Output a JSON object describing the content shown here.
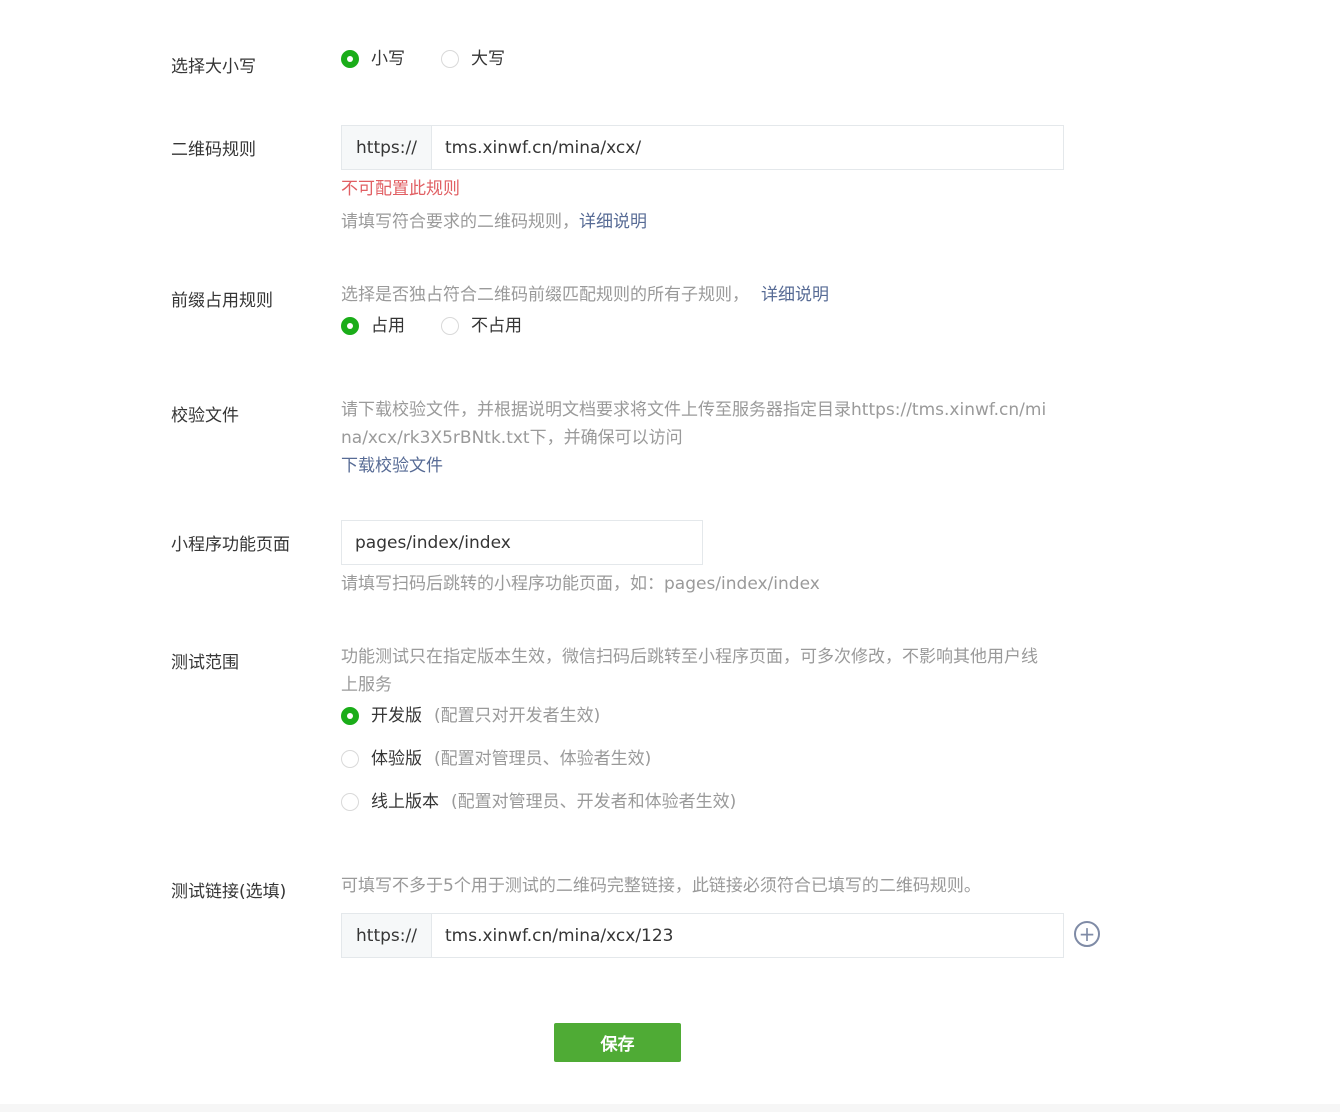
{
  "case": {
    "label": "选择大小写",
    "options": [
      {
        "label": "小写",
        "checked": true
      },
      {
        "label": "大写",
        "checked": false
      }
    ]
  },
  "qr_rule": {
    "label": "二维码规则",
    "prefix": "https://",
    "value": "tms.xinwf.cn/mina/xcx/",
    "error": "不可配置此规则",
    "hint": "请填写符合要求的二维码规则，",
    "hint_link": "详细说明"
  },
  "prefix_rule": {
    "label": "前缀占用规则",
    "hint": "选择是否独占符合二维码前缀匹配规则的所有子规则，",
    "hint_link": "详细说明",
    "options": [
      {
        "label": "占用",
        "checked": true
      },
      {
        "label": "不占用",
        "checked": false
      }
    ]
  },
  "verify_file": {
    "label": "校验文件",
    "hint_line1": "请下载校验文件，并根据说明文档要求将文件上传至服务器指定目录https://tms.xinwf.cn/mi",
    "hint_line2": "na/xcx/rk3X5rBNtk.txt下，并确保可以访问",
    "download_link": "下载校验文件"
  },
  "page_path": {
    "label": "小程序功能页面",
    "value": "pages/index/index",
    "hint": "请填写扫码后跳转的小程序功能页面，如：pages/index/index"
  },
  "test_scope": {
    "label": "测试范围",
    "hint_line1": "功能测试只在指定版本生效，微信扫码后跳转至小程序页面，可多次修改，不影响其他用户线",
    "hint_line2": "上服务",
    "options": [
      {
        "label": "开发版",
        "note": "(配置只对开发者生效)",
        "checked": true
      },
      {
        "label": "体验版",
        "note": "(配置对管理员、体验者生效)",
        "checked": false
      },
      {
        "label": "线上版本",
        "note": "(配置对管理员、开发者和体验者生效)",
        "checked": false
      }
    ]
  },
  "test_link": {
    "label": "测试链接(选填)",
    "hint": "可填写不多于5个用于测试的二维码完整链接，此链接必须符合已填写的二维码规则。",
    "prefix": "https://",
    "value": "tms.xinwf.cn/mina/xcx/123",
    "add_icon": "plus-circle-icon"
  },
  "save_label": "保存",
  "colors": {
    "accent_green": "#1aad19",
    "button_green": "#4fab35",
    "error_red": "#e15f63",
    "link_blue": "#576b95"
  }
}
